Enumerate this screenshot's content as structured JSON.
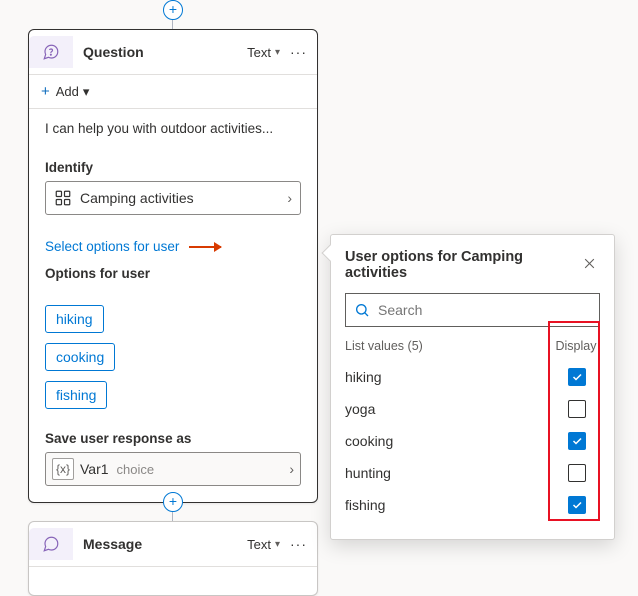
{
  "nodes": {
    "question": {
      "title": "Question",
      "type_label": "Text",
      "add_label": "Add",
      "message": "I can help you with outdoor activities...",
      "identify_label": "Identify",
      "identify_value": "Camping activities",
      "select_options_link": "Select options for user",
      "options_label": "Options for user",
      "options": [
        "hiking",
        "cooking",
        "fishing"
      ],
      "save_label": "Save user response as",
      "var_name": "Var1",
      "var_type": "choice"
    },
    "message_node": {
      "title": "Message",
      "type_label": "Text"
    }
  },
  "panel": {
    "title": "User options for Camping activities",
    "search_placeholder": "Search",
    "list_header": "List values (5)",
    "display_header": "Display",
    "rows": [
      {
        "name": "hiking",
        "checked": true
      },
      {
        "name": "yoga",
        "checked": false
      },
      {
        "name": "cooking",
        "checked": true
      },
      {
        "name": "hunting",
        "checked": false
      },
      {
        "name": "fishing",
        "checked": true
      }
    ]
  }
}
